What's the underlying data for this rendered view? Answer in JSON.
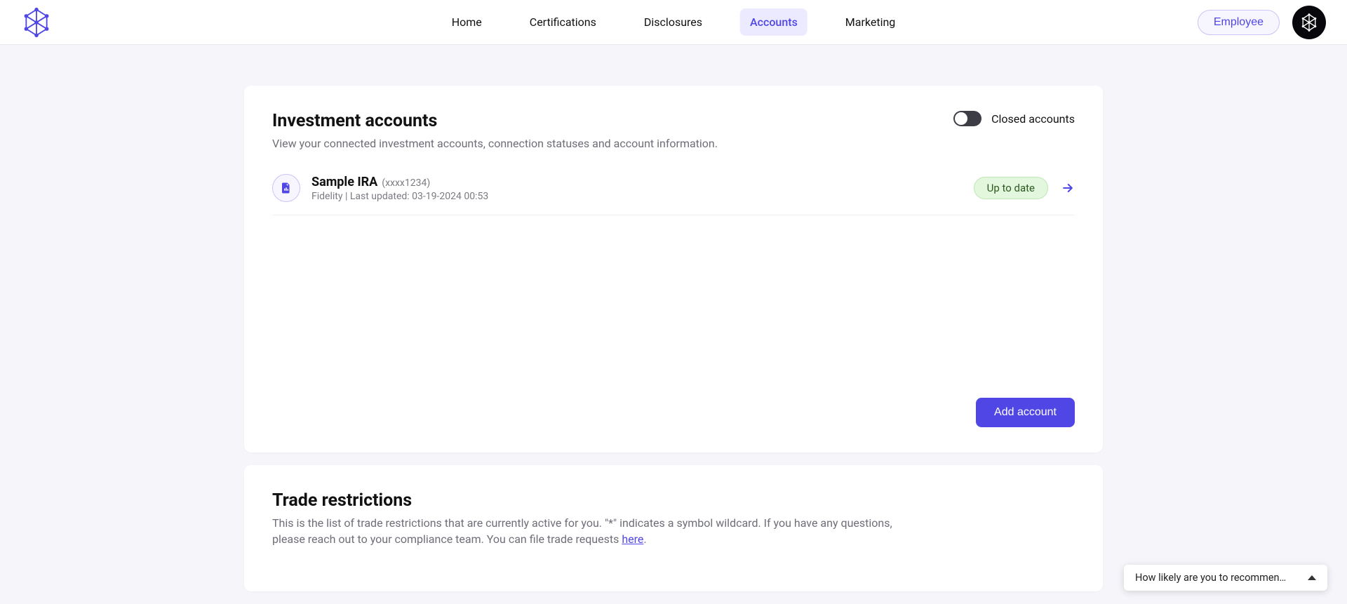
{
  "nav": {
    "items": [
      {
        "label": "Home"
      },
      {
        "label": "Certifications"
      },
      {
        "label": "Disclosures"
      },
      {
        "label": "Accounts"
      },
      {
        "label": "Marketing"
      }
    ],
    "active_index": 3
  },
  "header": {
    "role_label": "Employee"
  },
  "investment_card": {
    "title": "Investment accounts",
    "subtitle": "View your connected investment accounts, connection statuses and account information.",
    "closed_toggle_label": "Closed accounts",
    "add_button": "Add account",
    "accounts": [
      {
        "name": "Sample IRA",
        "masked": "(xxxx1234)",
        "provider": "Fidelity",
        "updated_prefix": "Last updated:",
        "updated_value": "03-19-2024 00:53",
        "status": "Up to date"
      }
    ]
  },
  "restrictions_card": {
    "title": "Trade restrictions",
    "body_part1": "This is the list of trade restrictions that are currently active for you. \"*\" indicates a symbol wildcard. If you have any questions, please reach out to your compliance team. You can file trade requests ",
    "link_text": "here",
    "body_part2": "."
  },
  "feedback": {
    "prompt": "How likely are you to recommen…"
  }
}
